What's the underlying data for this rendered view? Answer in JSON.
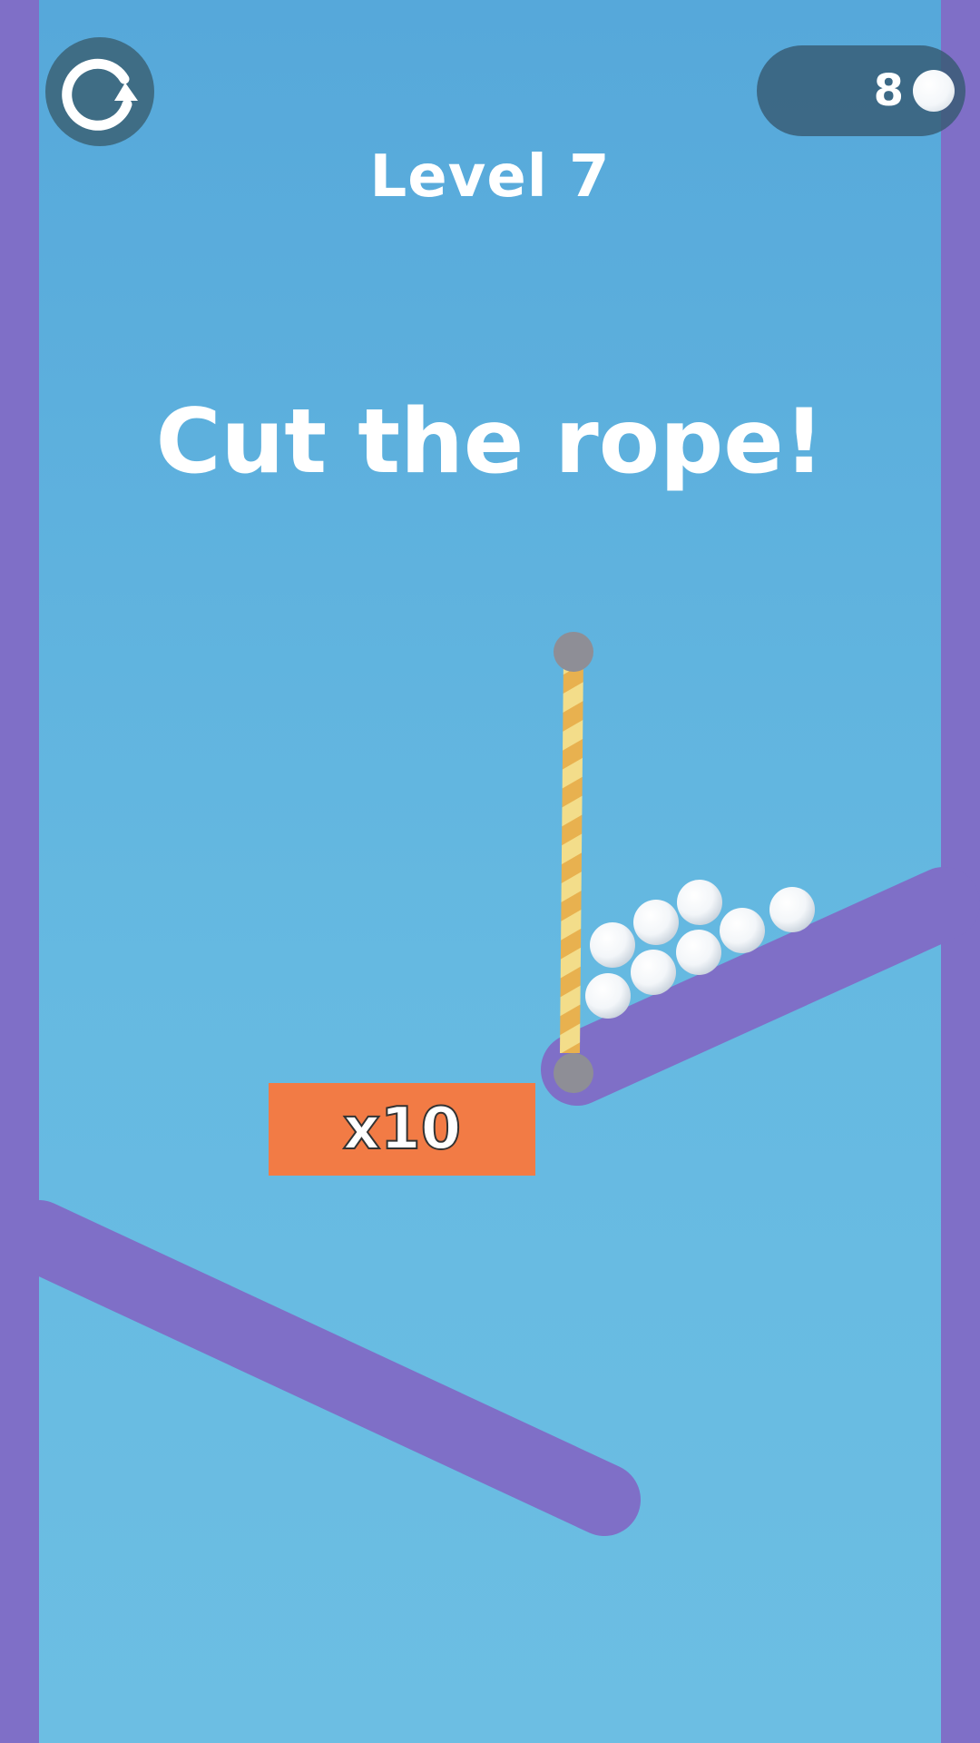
{
  "hud": {
    "restart_icon": "restart-icon",
    "ball_count": "8",
    "ball_icon": "white-ball-icon"
  },
  "level": {
    "title": "Level 7"
  },
  "instruction": "Cut the rope!",
  "multiplier": {
    "label": "x10"
  },
  "colors": {
    "background_top": "#56a8da",
    "background_bottom": "#6cbee3",
    "wall": "#7f6fc7",
    "rope_light": "#f3dd8a",
    "rope_dark": "#e8b14f",
    "pin": "#8e8e96",
    "multiplier_box": "#f27b45",
    "hud_panel": "#3f6d85"
  },
  "game_objects": {
    "balls_on_ramp": 8
  }
}
